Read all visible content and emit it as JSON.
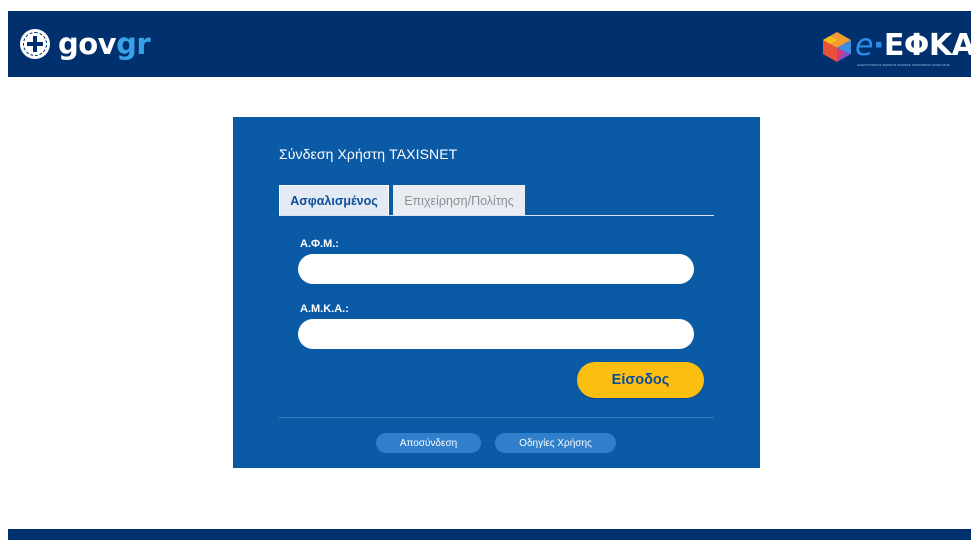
{
  "header": {
    "gov_logo_part1": "gov",
    "gov_logo_part2": "gr",
    "efka_logo_prefix": "e",
    "efka_logo_dot": "·",
    "efka_logo_main": "ΕΦΚΑ",
    "efka_subtitle": "ΗΛΕΚΤΡΟΝΙΚΟΣ ΕΘΝΙΚΟΣ ΦΟΡΕΑΣ ΚΟΙΝΩΝΙΚΗΣ ΑΣΦΑΛΙΣΗΣ"
  },
  "login": {
    "title": "Σύνδεση Χρήστη TAXISNET",
    "tabs": [
      {
        "label": "Ασφαλισμένος",
        "active": true
      },
      {
        "label": "Επιχείρηση/Πολίτης",
        "active": false
      }
    ],
    "afm_label": "Α.Φ.Μ.:",
    "afm_value": "",
    "amka_label": "Α.Μ.Κ.Α.:",
    "amka_value": "",
    "submit_label": "Είσοδος",
    "logout_label": "Αποσύνδεση",
    "help_label": "Οδηγίες Χρήσης"
  },
  "colors": {
    "header_bg": "#00306e",
    "panel_bg": "#0b5aa6",
    "accent_yellow": "#fdbe12",
    "gov_gr_blue": "#38a2e8"
  },
  "icons": {
    "gov_emblem": "greek-coat-of-arms-icon",
    "efka_cube": "efka-cube-icon"
  }
}
